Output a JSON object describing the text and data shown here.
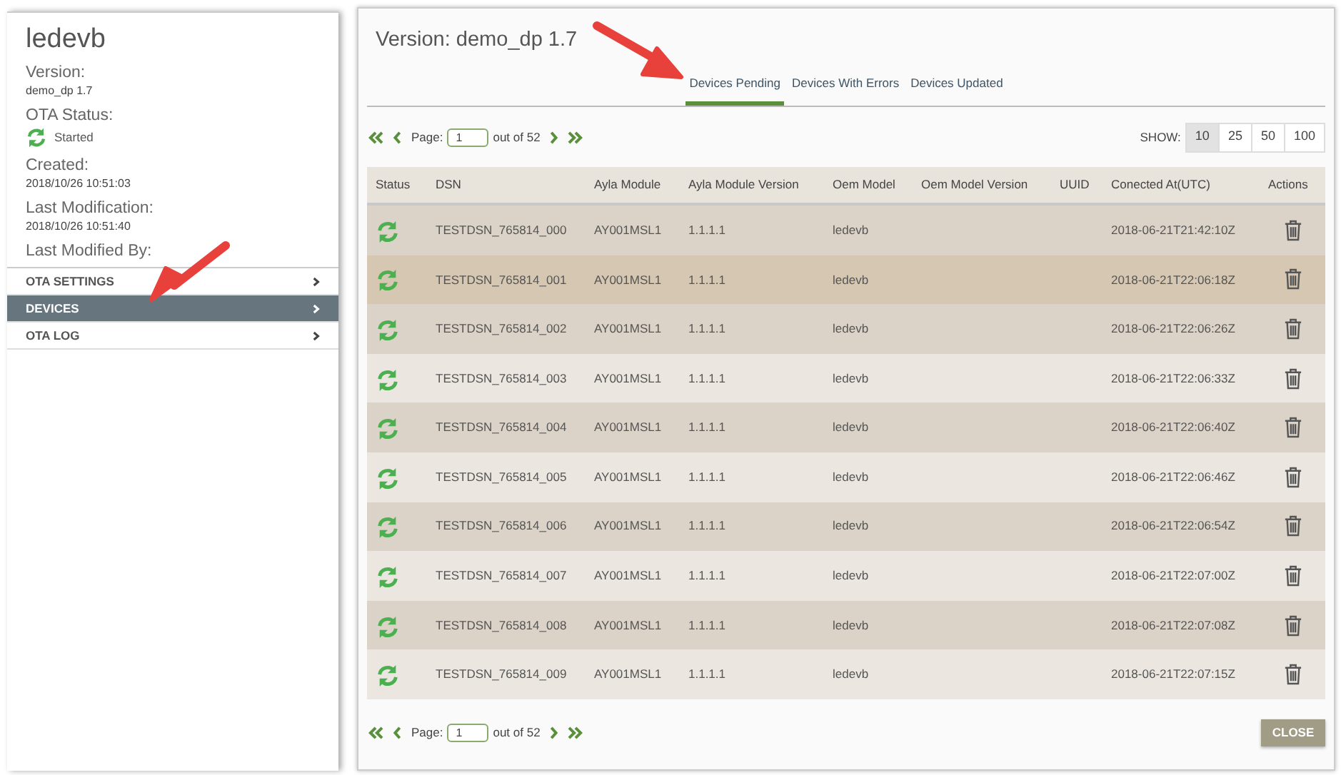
{
  "sidebar": {
    "title": "ledevb",
    "fields": [
      {
        "kind": "text",
        "label": "Version:",
        "value": "demo_dp 1.7"
      },
      {
        "kind": "status",
        "label": "OTA Status:",
        "value": "Started"
      },
      {
        "kind": "text",
        "label": "Created:",
        "value": "2018/10/26 10:51:03"
      },
      {
        "kind": "text",
        "label": "Last Modification:",
        "value": "2018/10/26 10:51:40"
      },
      {
        "kind": "text",
        "label": "Last Modified By:"
      }
    ],
    "menu": [
      {
        "label": "OTA SETTINGS",
        "selected": false
      },
      {
        "label": "DEVICES",
        "selected": true
      },
      {
        "label": "OTA LOG",
        "selected": false
      }
    ]
  },
  "main": {
    "title": "Version: demo_dp 1.7",
    "tabs": [
      {
        "label": "Devices Pending",
        "selected": true
      },
      {
        "label": "Devices With Errors",
        "selected": false
      },
      {
        "label": "Devices Updated",
        "selected": false
      }
    ],
    "pager_top": {
      "page_label": "Page:",
      "page": "1",
      "total": "out of 52"
    },
    "show": {
      "label": "SHOW:",
      "options": [
        {
          "label": "10",
          "selected": true
        },
        {
          "label": "25",
          "selected": false
        },
        {
          "label": "50",
          "selected": false
        },
        {
          "label": "100",
          "selected": false
        }
      ]
    },
    "table": {
      "columns": [
        "Status",
        "DSN",
        "Ayla Module",
        "Ayla Module Version",
        "Oem Model",
        "Oem Model Version",
        "UUID",
        "Conected At(UTC)",
        "Actions"
      ],
      "rows": [
        {
          "dsn": "TESTDSN_765814_000",
          "module": "AY001MSL1",
          "module_version": "1.1.1.1",
          "oem_model": "ledevb",
          "connected_at": "2018-06-21T21:42:10Z",
          "hovered": false
        },
        {
          "dsn": "TESTDSN_765814_001",
          "module": "AY001MSL1",
          "module_version": "1.1.1.1",
          "oem_model": "ledevb",
          "connected_at": "2018-06-21T22:06:18Z",
          "hovered": true
        },
        {
          "dsn": "TESTDSN_765814_002",
          "module": "AY001MSL1",
          "module_version": "1.1.1.1",
          "oem_model": "ledevb",
          "connected_at": "2018-06-21T22:06:26Z",
          "hovered": false
        },
        {
          "dsn": "TESTDSN_765814_003",
          "module": "AY001MSL1",
          "module_version": "1.1.1.1",
          "oem_model": "ledevb",
          "connected_at": "2018-06-21T22:06:33Z",
          "hovered": false
        },
        {
          "dsn": "TESTDSN_765814_004",
          "module": "AY001MSL1",
          "module_version": "1.1.1.1",
          "oem_model": "ledevb",
          "connected_at": "2018-06-21T22:06:40Z",
          "hovered": false
        },
        {
          "dsn": "TESTDSN_765814_005",
          "module": "AY001MSL1",
          "module_version": "1.1.1.1",
          "oem_model": "ledevb",
          "connected_at": "2018-06-21T22:06:46Z",
          "hovered": false
        },
        {
          "dsn": "TESTDSN_765814_006",
          "module": "AY001MSL1",
          "module_version": "1.1.1.1",
          "oem_model": "ledevb",
          "connected_at": "2018-06-21T22:06:54Z",
          "hovered": false
        },
        {
          "dsn": "TESTDSN_765814_007",
          "module": "AY001MSL1",
          "module_version": "1.1.1.1",
          "oem_model": "ledevb",
          "connected_at": "2018-06-21T22:07:00Z",
          "hovered": false
        },
        {
          "dsn": "TESTDSN_765814_008",
          "module": "AY001MSL1",
          "module_version": "1.1.1.1",
          "oem_model": "ledevb",
          "connected_at": "2018-06-21T22:07:08Z",
          "hovered": false
        },
        {
          "dsn": "TESTDSN_765814_009",
          "module": "AY001MSL1",
          "module_version": "1.1.1.1",
          "oem_model": "ledevb",
          "connected_at": "2018-06-21T22:07:15Z",
          "hovered": false
        }
      ]
    },
    "pager_bottom": {
      "page_label": "Page:",
      "page": "1",
      "total": "out of 52"
    },
    "close_button": "CLOSE"
  }
}
